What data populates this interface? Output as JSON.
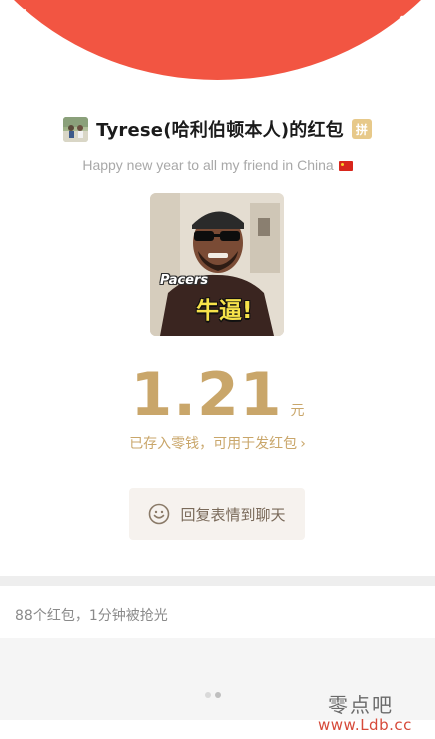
{
  "header": {
    "back_icon": "chevron-left-icon",
    "more_icon": "more-dots-icon",
    "color": "#f25542"
  },
  "sender": {
    "name": "Tyrese(哈利伯顿本人)的红包",
    "badge": "拼"
  },
  "greeting": "Happy new year to all my friend in China",
  "cover": {
    "caption_top": "Pacers",
    "caption_main": "牛逼!"
  },
  "amount": {
    "value": "1.21",
    "unit": "元",
    "color": "#c9a66a"
  },
  "saved_note": {
    "text": "已存入零钱，可用于发红包",
    "chevron": "›"
  },
  "reply_button": {
    "label": "回复表情到聊天",
    "icon": "smiley-icon"
  },
  "stats": {
    "text": "88个红包，1分钟被抢光"
  },
  "watermark": {
    "line1": "零点吧",
    "line2": "www.Ldb.cc"
  }
}
